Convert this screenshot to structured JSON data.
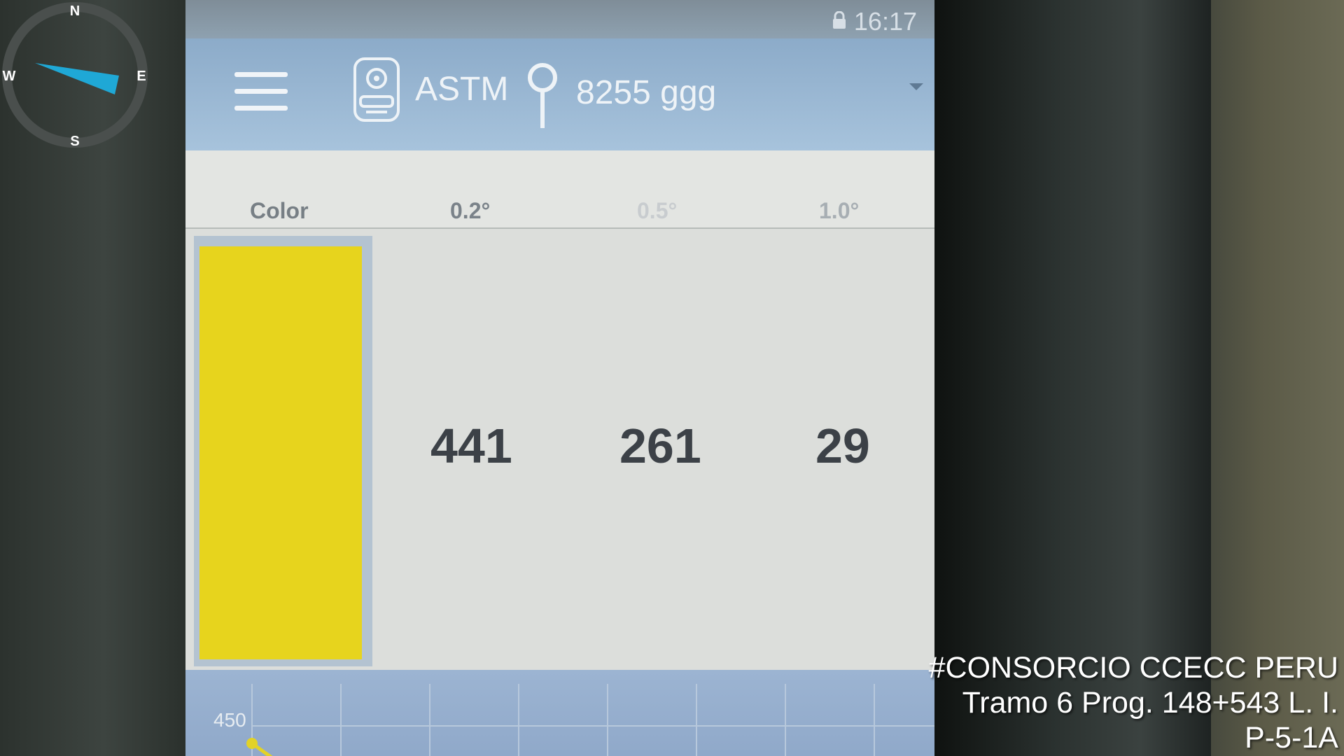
{
  "compass": {
    "north": "N",
    "east": "E",
    "south": "S",
    "west": "W",
    "needle_color": "#1fa8d6"
  },
  "status_bar": {
    "time": "16:17",
    "lock_icon": "lock-icon"
  },
  "app_bar": {
    "menu_icon": "hamburger-menu-icon",
    "device_icon": "retroreflectometer-device-icon",
    "standard": "ASTM",
    "location_icon": "map-pin-icon",
    "location": "8255 ggg",
    "dropdown_icon": "chevron-down-icon",
    "color": "#9ab8d3"
  },
  "table": {
    "headers": [
      "Color",
      "0.2°",
      "0.5°",
      "1.0°"
    ],
    "swatch_color": "#e7d41d",
    "values": [
      "441",
      "261",
      "29"
    ]
  },
  "chart": {
    "y_tick": "450"
  },
  "overlay": {
    "line1": "#CONSORCIO CCECC PERU",
    "line2": "Tramo 6 Prog. 148+543 L. I.",
    "line3": "P-5-1A"
  }
}
